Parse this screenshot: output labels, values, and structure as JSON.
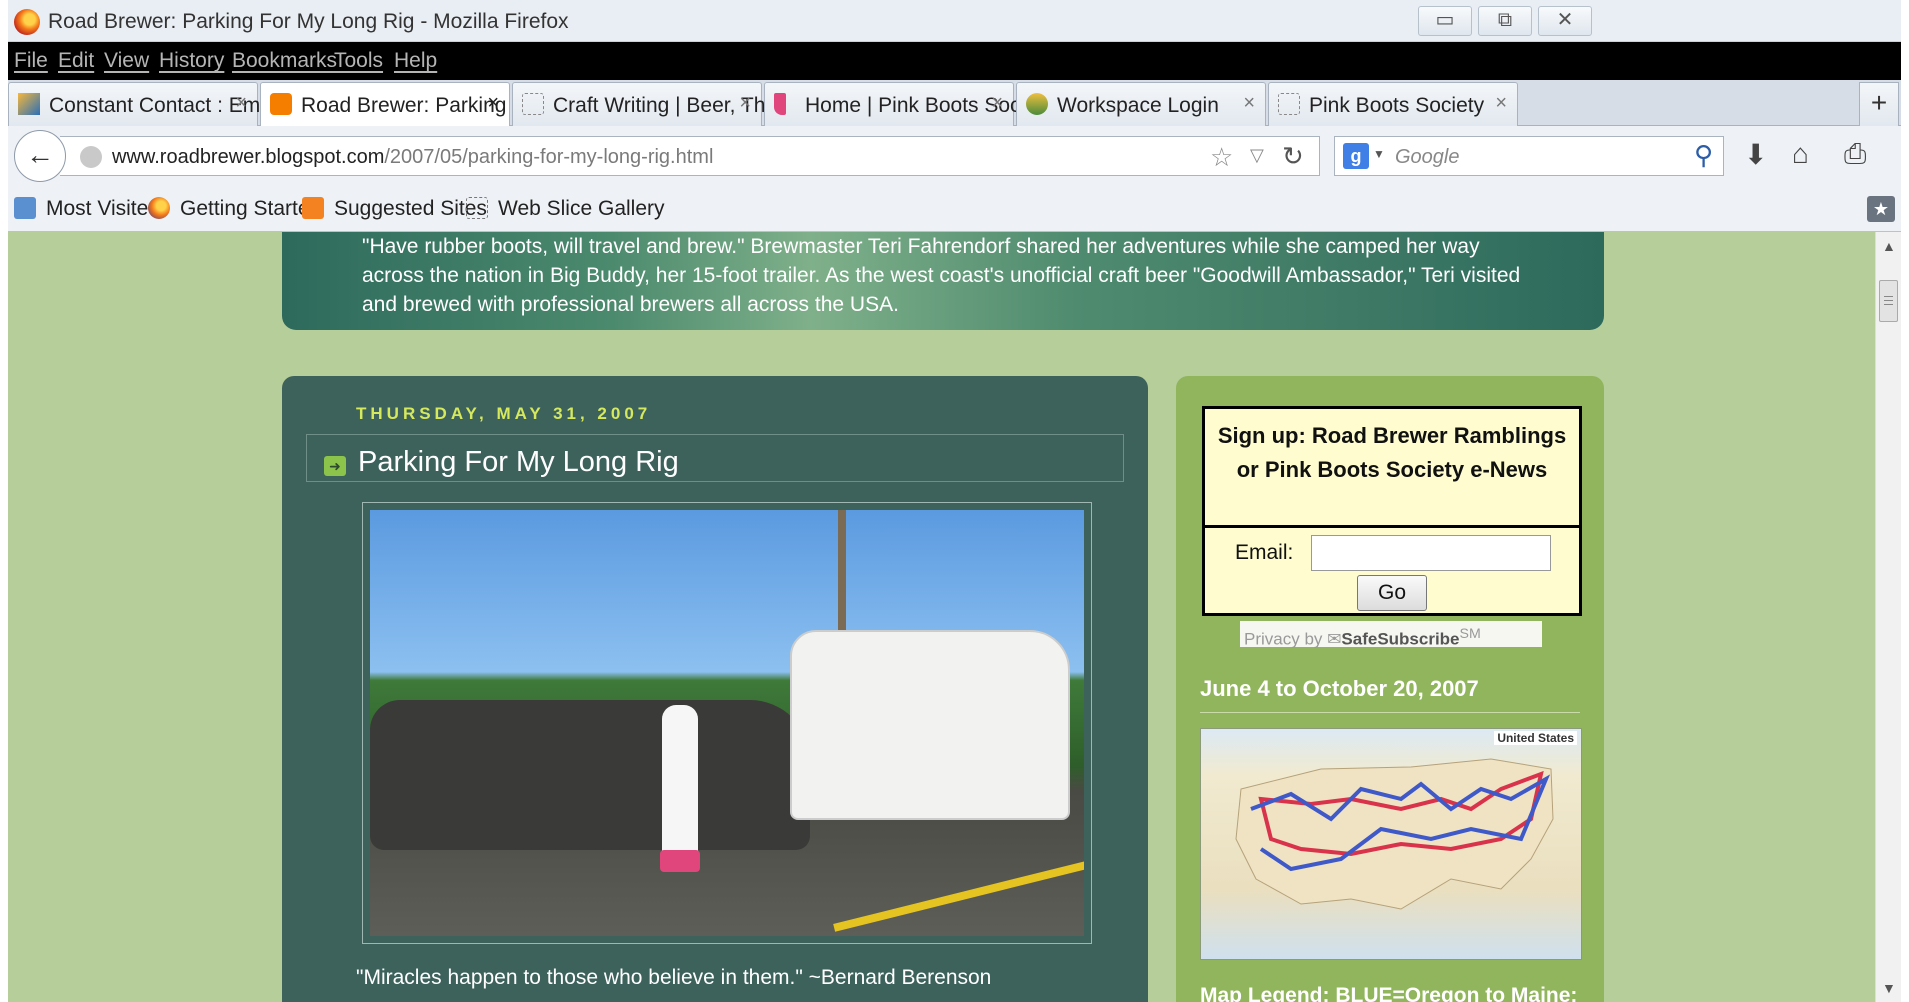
{
  "window": {
    "title": "Road Brewer: Parking For My Long Rig - Mozilla Firefox",
    "minimize": "▭",
    "restore": "⧉",
    "close": "✕"
  },
  "menu": [
    "File",
    "Edit",
    "View",
    "History",
    "Bookmarks",
    "Tools",
    "Help"
  ],
  "tabs": [
    {
      "label": "Constant Contact : Em...",
      "icon": "constant-contact-icon",
      "active": false
    },
    {
      "label": "Road Brewer: Parking F...",
      "icon": "blogger-icon",
      "active": true
    },
    {
      "label": "Craft Writing | Beer, Th...",
      "icon": "blank-page-icon",
      "active": false
    },
    {
      "label": "Home | Pink Boots Soc...",
      "icon": "pink-boot-icon",
      "active": false
    },
    {
      "label": "Workspace Login",
      "icon": "workspace-icon",
      "active": false
    },
    {
      "label": "Pink Boots Society",
      "icon": "blank-page-icon",
      "active": false
    }
  ],
  "tab_close": "×",
  "new_tab": "+",
  "nav": {
    "url_host": "www.roadbrewer.blogspot.com",
    "url_path": "/2007/05/parking-for-my-long-rig.html",
    "search_placeholder": "Google"
  },
  "bookmarks": [
    {
      "label": "Most Visited",
      "icon": "most-visited-icon"
    },
    {
      "label": "Getting Started",
      "icon": "firefox-icon"
    },
    {
      "label": "Suggested Sites",
      "icon": "suggested-sites-icon"
    },
    {
      "label": "Web Slice Gallery",
      "icon": "web-slice-icon"
    }
  ],
  "header": {
    "description": "\"Have rubber boots, will travel and brew.\" Brewmaster Teri Fahrendorf shared her adventures while she camped her way across the nation in Big Buddy, her 15-foot trailer. As the west coast's unofficial craft beer \"Goodwill Ambassador,\" Teri visited and brewed with professional brewers all across the USA."
  },
  "post": {
    "date": "THURSDAY, MAY 31, 2007",
    "title": "Parking For My Long Rig",
    "quote": "\"Miracles happen to those who believe in them.\" ~Bernard Berenson"
  },
  "sidebar": {
    "signup_title": "Sign up: Road Brewer Ramblings or Pink Boots Society e-News",
    "email_label": "Email:",
    "email_value": "",
    "go_label": "Go",
    "privacy_prefix": "Privacy by",
    "privacy_brand": "SafeSubscribe",
    "privacy_sup": "SM",
    "date_range": "June 4 to October 20, 2007",
    "map_label": "United States",
    "legend": "Map Legend: BLUE=Oregon to Maine:"
  },
  "colors": {
    "content_bg": "#b6cf9a",
    "main_col": "#3d625c",
    "side_col": "#91b55c",
    "date_accent": "#d6e85c"
  }
}
